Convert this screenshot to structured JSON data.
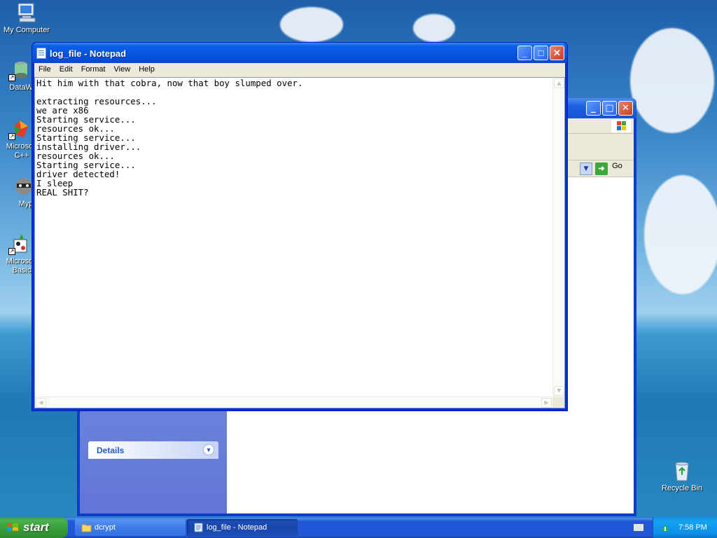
{
  "desktop": {
    "icons": [
      {
        "label": "My Computer"
      },
      {
        "label": "DataWa"
      },
      {
        "label": "Microsoft\nC++"
      },
      {
        "label": "Myp"
      },
      {
        "label": "Microsoft\nBasic"
      },
      {
        "label": "Recycle Bin"
      }
    ]
  },
  "explorer": {
    "details_label": "Details",
    "go_label": "Go"
  },
  "notepad": {
    "title": "log_file - Notepad",
    "menu": [
      "File",
      "Edit",
      "Format",
      "View",
      "Help"
    ],
    "content": "Hit him with that cobra, now that boy slumped over.\n\nextracting resources...\nwe are x86\nStarting service...\nresources ok...\nStarting service...\ninstalling driver...\nresources ok...\nStarting service...\ndriver detected!\nI sleep\nREAL SHIT?"
  },
  "taskbar": {
    "start_label": "start",
    "buttons": [
      {
        "label": "dcrypt",
        "icon": "folder-icon"
      },
      {
        "label": "log_file - Notepad",
        "icon": "notepad-icon"
      }
    ],
    "clock": "7:58 PM"
  },
  "colors": {
    "titlebar": "#0653de",
    "start": "#379e37",
    "tray": "#0d8ee8"
  }
}
